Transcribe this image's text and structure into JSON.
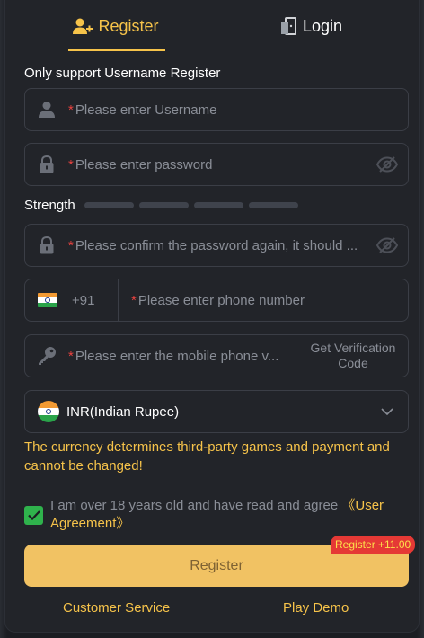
{
  "tabs": {
    "register": "Register",
    "login": "Login"
  },
  "form": {
    "hint_title": "Only support Username Register",
    "required_mark": "*",
    "username_placeholder": "Please enter Username",
    "password_placeholder": "Please enter password",
    "strength_label": "Strength",
    "strength_segments": 4,
    "confirm_placeholder": "Please confirm the password again, it should ...",
    "phone": {
      "dial_code": "+91",
      "placeholder": "Please enter phone number"
    },
    "verification": {
      "placeholder": "Please enter the mobile phone v...",
      "button_line1": "Get Verification",
      "button_line2": "Code"
    },
    "currency": {
      "value": "INR(Indian Rupee)"
    },
    "currency_warning": "The currency determines third-party games and payment and cannot be changed!",
    "agreement": {
      "checked": true,
      "text": "I am over 18 years old and have read and agree ",
      "link": "《User Agreement》"
    },
    "register_button": "Register",
    "bonus_badge": "Register +11.00"
  },
  "footer": {
    "customer_service": "Customer Service",
    "play_demo": "Play Demo"
  },
  "colors": {
    "accent": "#f6c34a",
    "button": "#f1c263",
    "checkbox": "#2fb24c",
    "badge": "#e53935",
    "panel": "#222429",
    "required": "#e9423f"
  }
}
